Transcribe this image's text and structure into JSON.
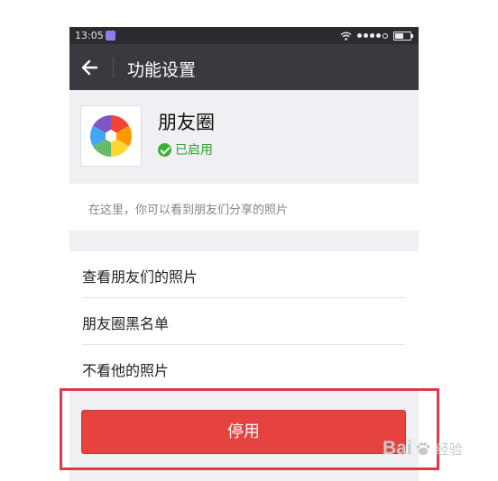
{
  "status_bar": {
    "time": "13:05"
  },
  "nav": {
    "title": "功能设置"
  },
  "plugin": {
    "name": "朋友圈",
    "status": "已启用"
  },
  "description": "在这里，你可以看到朋友们分享的照片",
  "menu": {
    "items": [
      {
        "label": "查看朋友们的照片"
      },
      {
        "label": "朋友圈黑名单"
      },
      {
        "label": "不看他的照片"
      }
    ]
  },
  "disable_button": {
    "label": "停用"
  },
  "watermark": {
    "text_bai": "Bai",
    "text_jy": "经验"
  },
  "colors": {
    "nav_bg": "#393a3f",
    "status_bg": "#2b2c2f",
    "button_red": "#e64340",
    "enabled_green": "#2fa12c",
    "highlight_border": "#e0394a"
  },
  "icons": {
    "back": "arrow-left-icon",
    "plugin": "aperture-icon",
    "status": "check-circle-icon"
  }
}
